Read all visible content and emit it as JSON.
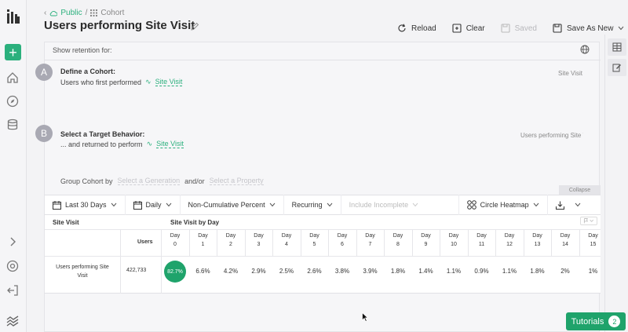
{
  "breadcrumb": {
    "root": "Public",
    "sep": "/",
    "current": "Cohort"
  },
  "title": "Users performing Site Visit",
  "toolbar": {
    "reload": "Reload",
    "clear": "Clear",
    "saved": "Saved",
    "save_as_new": "Save As New"
  },
  "panel": {
    "show_retention": "Show retention for:",
    "step_a": {
      "badge": "A",
      "title": "Define a Cohort:",
      "desc": "Users who first performed",
      "event": "Site Visit",
      "right_label": "Site Visit"
    },
    "step_b": {
      "badge": "B",
      "title": "Select a Target Behavior:",
      "desc": "... and returned to perform",
      "event": "Site Visit",
      "right_label": "Users performing Site V"
    },
    "group_by": {
      "label": "Group Cohort by",
      "generation": "Select a Generation",
      "andor": "and/or",
      "property": "Select a Property"
    },
    "collapse": "Collapse"
  },
  "controls": {
    "range": "Last 30 Days",
    "interval": "Daily",
    "mode": "Non-Cumulative Percent",
    "type": "Recurring",
    "incomplete": "Include Incomplete",
    "view": "Circle Heatmap"
  },
  "table": {
    "col_event": "Site Visit",
    "col_by_day": "Site Visit by Day",
    "users_header": "Users",
    "day_word": "Day",
    "days": [
      "0",
      "1",
      "2",
      "3",
      "4",
      "5",
      "6",
      "7",
      "8",
      "9",
      "10",
      "11",
      "12",
      "13",
      "14",
      "15"
    ],
    "row_label_line1": "Users performing Site",
    "row_label_line2": "Visit",
    "row_users": "422,733",
    "row_values": [
      "82.7%",
      "6.6%",
      "4.2%",
      "2.9%",
      "2.5%",
      "2.6%",
      "3.8%",
      "3.9%",
      "1.8%",
      "1.4%",
      "1.1%",
      "0.9%",
      "1.1%",
      "1.8%",
      "2%",
      "1%"
    ]
  },
  "tutorials": {
    "label": "Tutorials",
    "count": "2"
  },
  "colors": {
    "accent": "#2bb07d",
    "heat": "#1fa36b"
  }
}
